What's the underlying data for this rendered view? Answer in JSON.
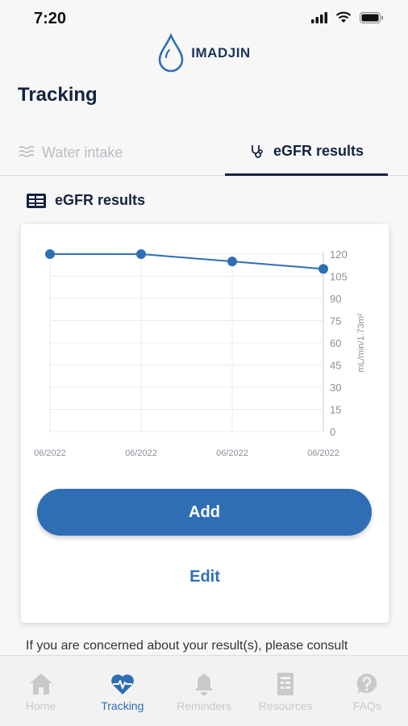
{
  "status": {
    "time": "7:20"
  },
  "brand": {
    "name": "IMADJIN"
  },
  "page": {
    "title": "Tracking"
  },
  "tabs": [
    {
      "label": "Water intake",
      "active": false,
      "icon": "water-icon"
    },
    {
      "label": "eGFR results",
      "active": true,
      "icon": "stethoscope-icon"
    }
  ],
  "section": {
    "title": "eGFR results",
    "icon": "report-icon"
  },
  "chart_data": {
    "type": "line",
    "x": [
      "06/2022",
      "06/2022",
      "06/2022",
      "06/2022"
    ],
    "values": [
      120,
      120,
      115,
      110
    ],
    "ylabel": "mL/min/1.73m²",
    "yticks": [
      0,
      15,
      30,
      45,
      60,
      75,
      90,
      105,
      120
    ],
    "ylim": [
      0,
      120
    ],
    "y_axis_side": "right",
    "grid": true,
    "line_color": "#2f6eb5"
  },
  "actions": {
    "add_label": "Add",
    "edit_label": "Edit"
  },
  "disclaimer": "If you are concerned about your result(s), please consult",
  "nav": [
    {
      "label": "Home",
      "icon": "home-icon",
      "active": false
    },
    {
      "label": "Tracking",
      "icon": "heart-pulse-icon",
      "active": true
    },
    {
      "label": "Reminders",
      "icon": "bell-icon",
      "active": false
    },
    {
      "label": "Resources",
      "icon": "document-icon",
      "active": false
    },
    {
      "label": "FAQs",
      "icon": "question-icon",
      "active": false
    }
  ],
  "colors": {
    "accent": "#2f6eb5",
    "navy": "#14233f",
    "inactive": "#c9c9c9"
  }
}
